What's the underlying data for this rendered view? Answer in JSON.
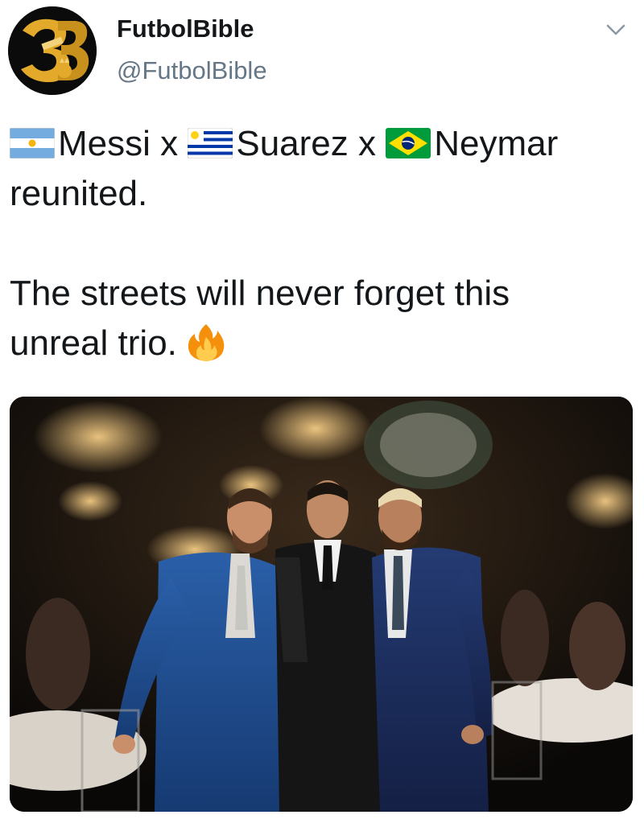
{
  "account": {
    "display_name": "FutbolBible",
    "handle": "@FutbolBible",
    "avatar_icon": "futbolbible-logo"
  },
  "tweet": {
    "line1": {
      "flag1": "argentina-flag",
      "text1": "Messi x ",
      "flag2": "uruguay-flag",
      "text2": "Suarez x ",
      "flag3": "brazil-flag",
      "text3": "Neymar"
    },
    "line2": "reunited.",
    "line3": "The streets will never forget this",
    "line4": "unreal trio.",
    "emoji": "fire-emoji"
  },
  "media": {
    "type": "photo",
    "subject": "three footballers in suits at a banquet hall with chandeliers"
  },
  "colors": {
    "text": "#14171a",
    "secondary": "#657786",
    "avatar_gold": "#e3a92a"
  }
}
